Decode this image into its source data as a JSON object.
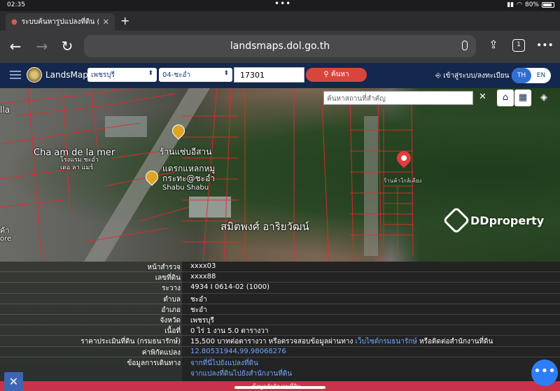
{
  "status_bar": {
    "time": "02:35",
    "battery": "80%"
  },
  "browser": {
    "tab_title": "ระบบค้นหารูปแปลงที่ดิน (La",
    "url": "landsmaps.dol.go.th",
    "tab_count": "1"
  },
  "app": {
    "brand": "LandsMaps",
    "province_select": "เพชรบุรี",
    "district_select": "04-ชะอำ",
    "parcel_number": "17301",
    "search_label": "ค้นหา",
    "login_label": "เข้าสู่ระบบ/ลงทะเบียน",
    "lang_th": "TH",
    "lang_en": "EN"
  },
  "map": {
    "search_placeholder": "ค้นหาสถานที่สำคัญ",
    "labels": {
      "villa": "lla",
      "chaam": "Cha am de la mer",
      "hotel": "โรงแรม ชะอำ เดอ ลา แมร์",
      "shop": "ร้านแซ่บอีสาน",
      "shabu": "แดรกแหลกหมู กระทะ@ชะอำ",
      "shabu_en": "Shabu Shabu",
      "temple": "สมิตพงศ์ อาริยวัฒน์",
      "pin_label": "ร้านค้าใกล้เคียง",
      "left_edge": "ค้า",
      "left_edge2": "ore"
    },
    "watermark": "DDproperty"
  },
  "parcel_info": [
    {
      "key": "หน้าสำรวจ",
      "value": "xxxx03"
    },
    {
      "key": "เลขที่ดิน",
      "value": "xxxx88"
    },
    {
      "key": "ระวาง",
      "value": "4934 I 0614-02 (1000)"
    },
    {
      "key": "ตำบล",
      "value": "ชะอำ"
    },
    {
      "key": "อำเภอ",
      "value": "ชะอำ"
    },
    {
      "key": "จังหวัด",
      "value": "เพชรบุรี"
    },
    {
      "key": "เนื้อที่",
      "value": "0 ไร่ 1 งาน 5.0 ตารางวา"
    }
  ],
  "price_row": {
    "key": "ราคาประเมินที่ดิน (กรมธนารักษ์)",
    "value_pre": "15,500 บาทต่อตารางวา หรือตรวจสอบข้อมูลผ่านทาง",
    "link": "เว็บไซต์กรมธนารักษ์",
    "value_post": "หรือติดต่อสำนักงานที่ดิน"
  },
  "coord_row": {
    "key": "ค่าพิกัดแปลง",
    "value": "12.80531944,99.98068276"
  },
  "travel_row": {
    "key": "ข้อมูลการเดินทาง",
    "link1": "จากที่นี่ไปยังแปลงที่ดิน",
    "link2": "จากแปลงที่ดินไปยังสำนักงานที่ดิน"
  },
  "bottom_bar": {
    "text": "ข้อมูลสำนักงานที่ดิน"
  }
}
